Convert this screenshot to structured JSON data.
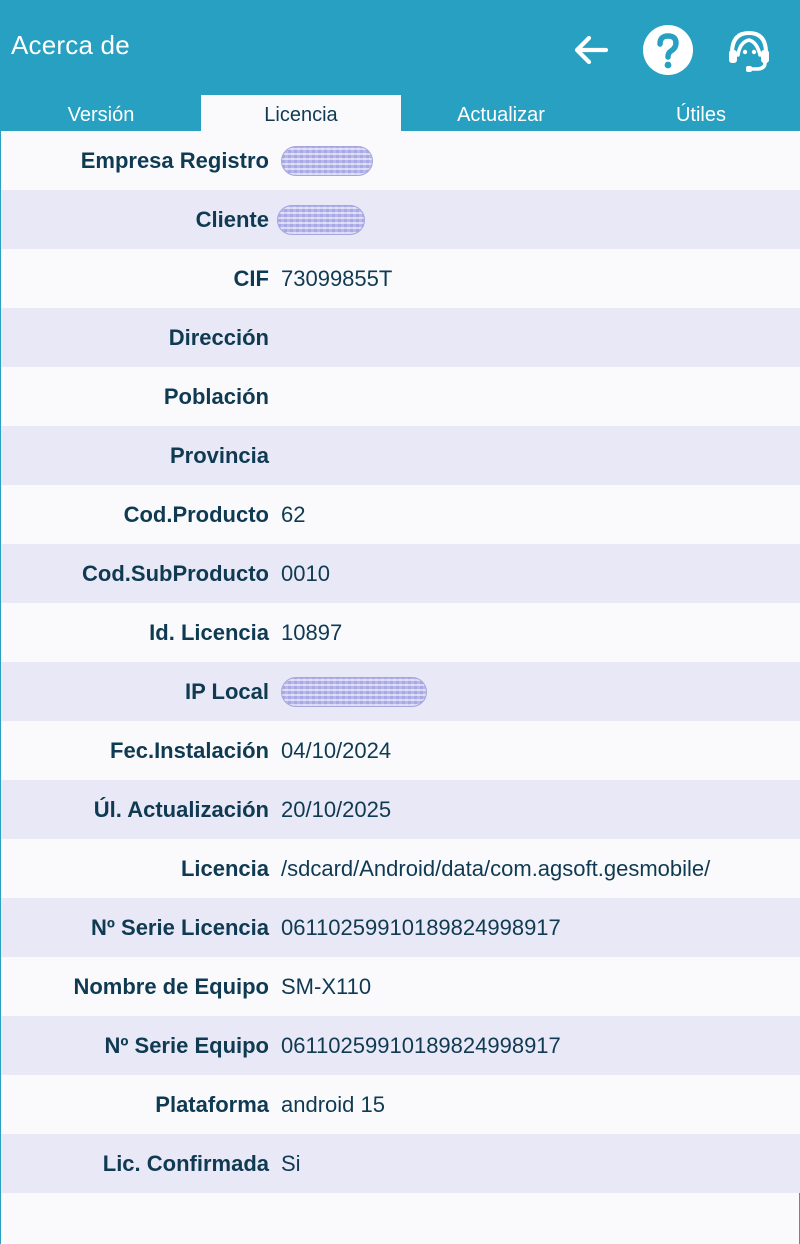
{
  "appbar": {
    "title": "Acerca de",
    "icons": [
      "arrow-back-icon",
      "help-icon",
      "support-agent-icon"
    ]
  },
  "tabs": [
    {
      "label": "Versión",
      "active": false
    },
    {
      "label": "Licencia",
      "active": true
    },
    {
      "label": "Actualizar",
      "active": false
    },
    {
      "label": "Útiles",
      "active": false
    }
  ],
  "rows": [
    {
      "label": "Empresa Registro",
      "value": "",
      "redacted": true
    },
    {
      "label": "Cliente",
      "value": "",
      "redacted": true
    },
    {
      "label": "CIF",
      "value": "73099855T"
    },
    {
      "label": "Dirección",
      "value": ""
    },
    {
      "label": "Población",
      "value": ""
    },
    {
      "label": "Provincia",
      "value": ""
    },
    {
      "label": "Cod.Producto",
      "value": "62"
    },
    {
      "label": "Cod.SubProducto",
      "value": "0010"
    },
    {
      "label": "Id. Licencia",
      "value": "10897"
    },
    {
      "label": "IP Local",
      "value": "",
      "redacted": true
    },
    {
      "label": "Fec.Instalación",
      "value": "04/10/2024"
    },
    {
      "label": "Úl. Actualización",
      "value": "20/10/2025"
    },
    {
      "label": "Licencia",
      "value": "/sdcard/Android/data/com.agsoft.gesmobile/"
    },
    {
      "label": "Nº Serie Licencia",
      "value": "06110259910189824998917"
    },
    {
      "label": "Nombre de Equipo",
      "value": "SM-X110"
    },
    {
      "label": "Nº Serie Equipo",
      "value": "06110259910189824998917"
    },
    {
      "label": "Plataforma",
      "value": "android 15"
    },
    {
      "label": "Lic. Confirmada",
      "value": "Si"
    }
  ],
  "colors": {
    "appbar": "#27a0c1",
    "text": "#0f3a52",
    "row_alt": "#e8e8f6",
    "row_bg": "#fafafd"
  }
}
